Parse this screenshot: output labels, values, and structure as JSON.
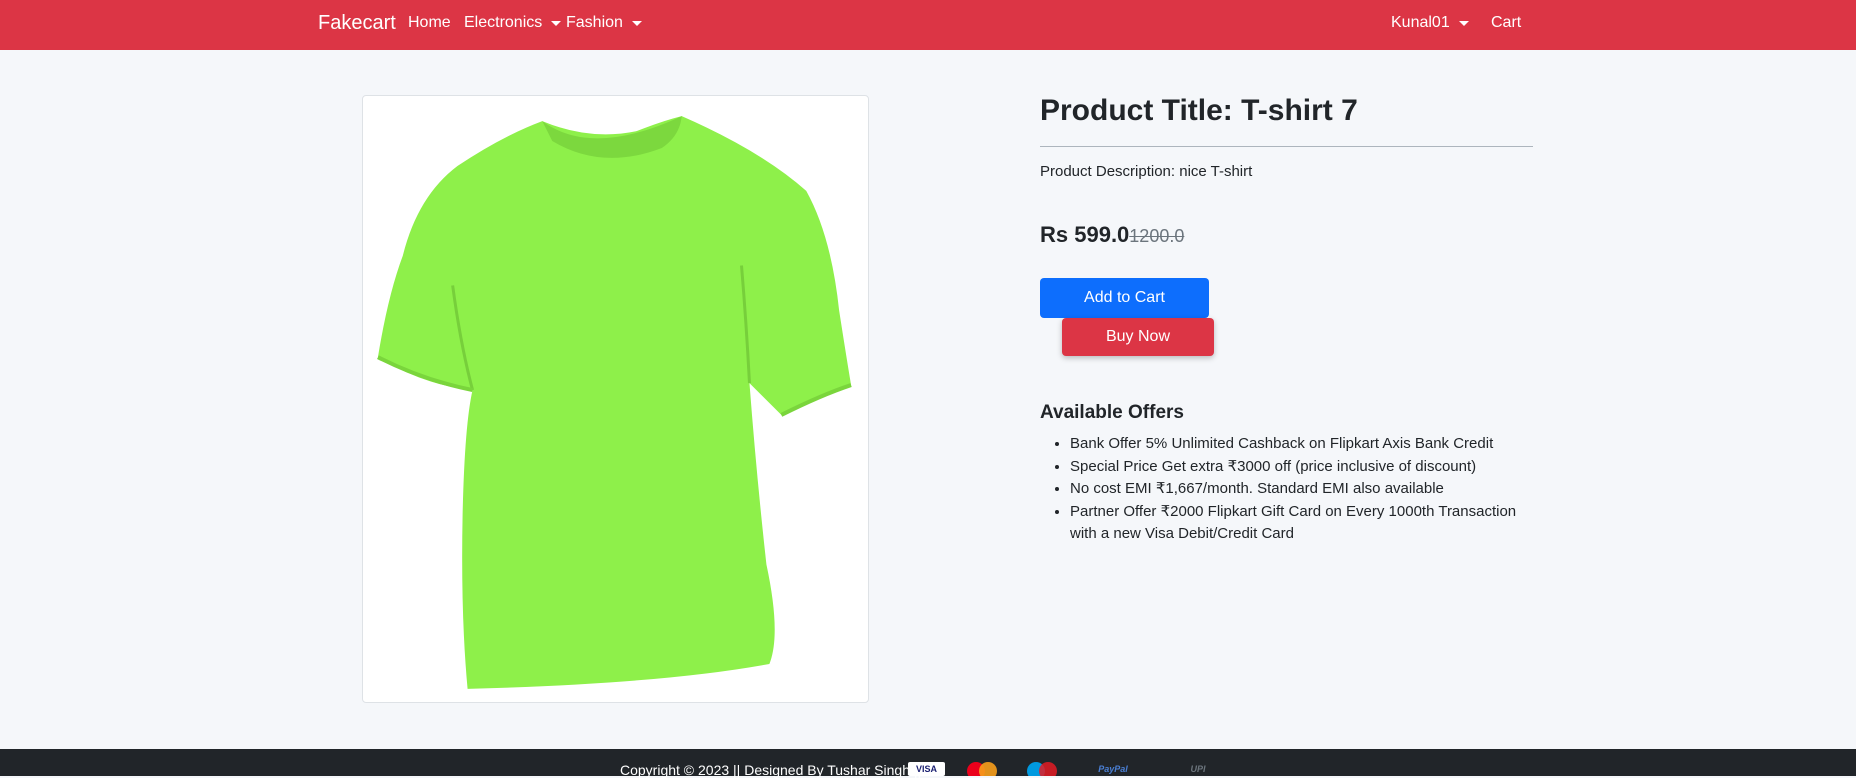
{
  "navbar": {
    "brand": "Fakecart",
    "home": "Home",
    "electronics": "Electronics",
    "fashion": "Fashion",
    "user": "Kunal01",
    "cart": "Cart"
  },
  "product": {
    "title": "Product Title: T-shirt 7",
    "description": "Product Description: nice T-shirt",
    "price": "Rs 599.0",
    "original_price": "1200.0",
    "image_color": "#8ef04a"
  },
  "buttons": {
    "add_to_cart": "Add to Cart",
    "buy_now": "Buy Now"
  },
  "offers": {
    "heading": "Available Offers",
    "items": [
      "Bank Offer 5% Unlimited Cashback on Flipkart Axis Bank Credit",
      "Special Price Get extra ₹3000 off (price inclusive of discount)",
      "No cost EMI ₹1,667/month. Standard EMI also available",
      "Partner Offer ₹2000 Flipkart Gift Card on Every 1000th Transaction with a new Visa Debit/Credit Card"
    ]
  },
  "footer": {
    "text": "Copyright © 2023 || Designed By Tushar Singh ||",
    "payment_logos": [
      "VISA",
      "MasterCard",
      "Maestro",
      "PayPal",
      "UPI"
    ]
  },
  "colors": {
    "navbar": "#dc3545",
    "primary": "#0d6efd",
    "danger": "#dc3545",
    "footer": "#212529"
  }
}
